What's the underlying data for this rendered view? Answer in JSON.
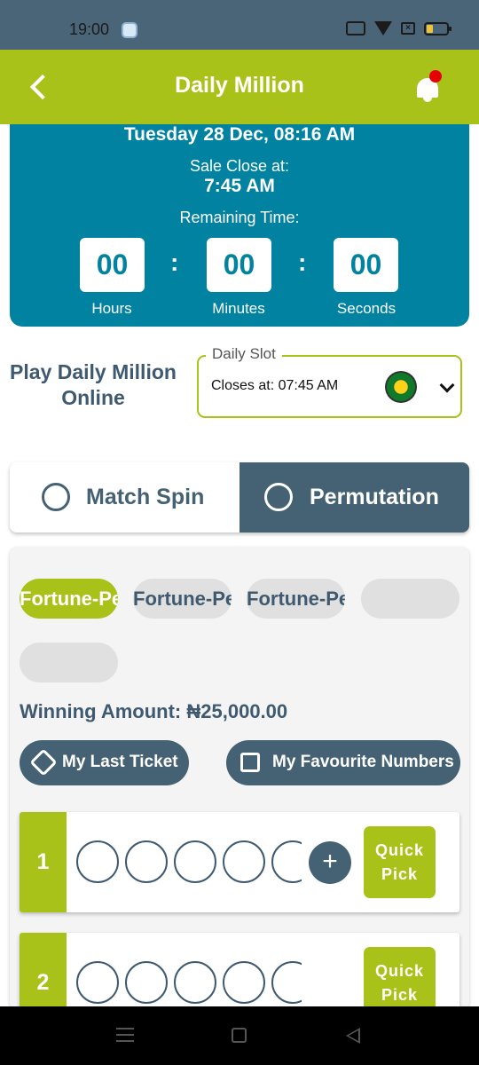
{
  "status_bar": {
    "time": "19:00"
  },
  "header": {
    "title": "Daily Million"
  },
  "timer": {
    "date": "Tuesday 28 Dec, 08:16 AM",
    "sale_close_label": "Sale Close at:",
    "sale_close_time": "7:45 AM",
    "remaining_label": "Remaining Time:",
    "hours": "00",
    "minutes": "00",
    "seconds": "00",
    "hours_label": "Hours",
    "minutes_label": "Minutes",
    "seconds_label": "Seconds",
    "colon": ":"
  },
  "play": {
    "title": "Play Daily Million Online",
    "slot_label": "Daily Slot",
    "slot_value": "Closes at: 07:45 AM"
  },
  "tabs": [
    {
      "label": "Match Spin",
      "active": false
    },
    {
      "label": "Permutation",
      "active": true
    }
  ],
  "chips": [
    "Fortune-Per",
    "Fortune-Per",
    "Fortune-Per",
    "",
    ""
  ],
  "winning_amount": "Winning Amount: ₦25,000.00",
  "buttons": {
    "last_ticket": "My Last Ticket",
    "favourite_numbers": "My Favourite Numbers"
  },
  "tickets": [
    {
      "number": "1",
      "quick_pick": "Quick Pick"
    },
    {
      "number": "2",
      "quick_pick": "Quick Pick"
    }
  ],
  "add_symbol": "+",
  "colors": {
    "accent_green": "#a8c21a",
    "teal": "#0082a0",
    "slate": "#456274",
    "notification_red": "#e60000"
  }
}
